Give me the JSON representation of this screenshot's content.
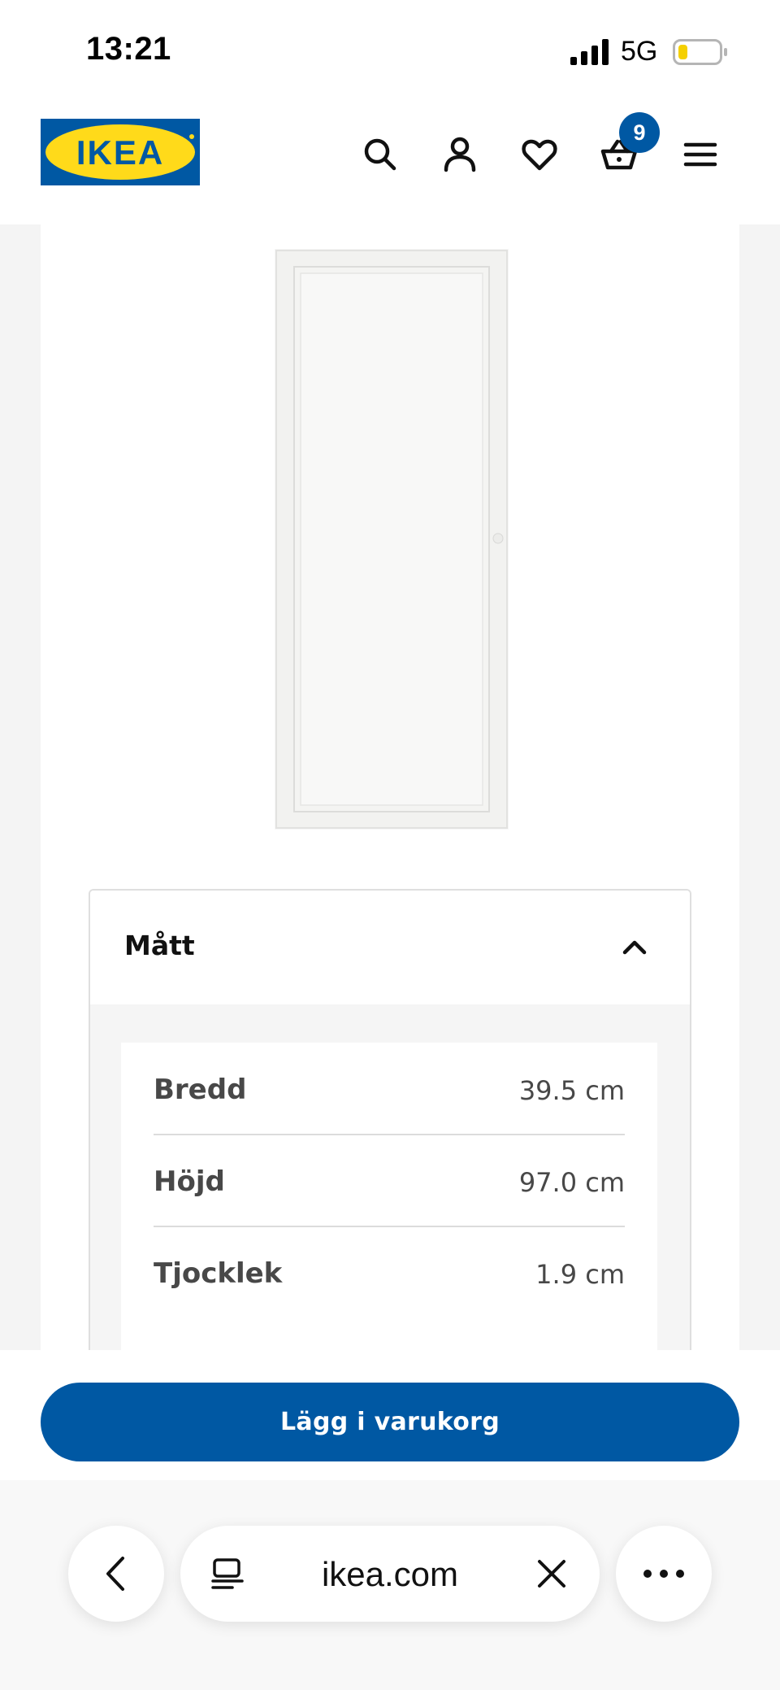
{
  "status_bar": {
    "time": "13:21",
    "network": "5G",
    "battery_color": "#f5d000"
  },
  "header": {
    "logo_text": "IKEA",
    "cart_count": "9",
    "icons": [
      "search-icon",
      "account-icon",
      "heart-icon",
      "cart-icon",
      "menu-icon"
    ]
  },
  "product": {
    "image": "white-glass-door-panel"
  },
  "dimensions": {
    "title": "Mått",
    "expanded": true,
    "rows": [
      {
        "label": "Bredd",
        "value": "39.5 cm"
      },
      {
        "label": "Höjd",
        "value": "97.0 cm"
      },
      {
        "label": "Tjocklek",
        "value": "1.9 cm"
      }
    ]
  },
  "cta": {
    "label": "Lägg i varukorg"
  },
  "browser": {
    "url": "ikea.com",
    "icons": [
      "back-chevron-icon",
      "tabs-icon",
      "close-icon",
      "more-icon"
    ]
  },
  "colors": {
    "brand_blue": "#0058a3",
    "brand_yellow": "#ffda1a"
  }
}
